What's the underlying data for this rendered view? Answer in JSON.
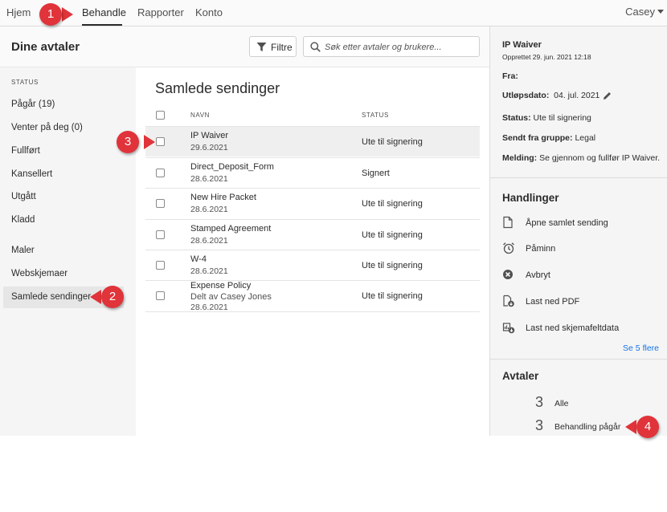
{
  "topnav": {
    "tabs": [
      "Hjem",
      "Behandle",
      "Rapporter",
      "Konto"
    ],
    "active_tab": "Behandle",
    "user": "Casey"
  },
  "header": {
    "title": "Dine avtaler",
    "filter_label": "Filtre",
    "search_placeholder": "Søk etter avtaler og brukere..."
  },
  "sidebar": {
    "status_heading": "STATUS",
    "items": [
      "Pågår (19)",
      "Venter på deg (0)",
      "Fullført",
      "Kansellert",
      "Utgått",
      "Kladd",
      "Maler",
      "Webskjemaer",
      "Samlede sendinger"
    ],
    "active": "Samlede sendinger"
  },
  "main": {
    "title": "Samlede sendinger",
    "col_name": "NAVN",
    "col_status": "STATUS",
    "rows": [
      {
        "name": "IP Waiver",
        "sub": "",
        "date": "29.6.2021",
        "status": "Ute til signering"
      },
      {
        "name": "Direct_Deposit_Form",
        "sub": "",
        "date": "28.6.2021",
        "status": "Signert"
      },
      {
        "name": "New Hire Packet",
        "sub": "",
        "date": "28.6.2021",
        "status": "Ute til signering"
      },
      {
        "name": "Stamped Agreement",
        "sub": "",
        "date": "28.6.2021",
        "status": "Ute til signering"
      },
      {
        "name": "W-4",
        "sub": "",
        "date": "28.6.2021",
        "status": "Ute til signering"
      },
      {
        "name": "Expense Policy",
        "sub": "Delt av Casey Jones",
        "date": "28.6.2021",
        "status": "Ute til signering"
      }
    ]
  },
  "details": {
    "name": "IP Waiver",
    "created": "Opprettet 29. jun. 2021 12:18",
    "from_label": "Fra:",
    "expiry_label": "Utløpsdato:",
    "expiry_value": "04. jul. 2021",
    "status_label": "Status:",
    "status_value": "Ute til signering",
    "group_label": "Sendt fra gruppe:",
    "group_value": "Legal",
    "message_label": "Melding:",
    "message_value": "Se gjennom og fullfør IP Waiver."
  },
  "actions": {
    "heading": "Handlinger",
    "items": [
      "Åpne samlet sending",
      "Påminn",
      "Avbryt",
      "Last ned PDF",
      "Last ned skjemafeltdata"
    ],
    "more": "Se 5 flere"
  },
  "agreements": {
    "heading": "Avtaler",
    "counts": [
      {
        "num": "3",
        "label": "Alle"
      },
      {
        "num": "3",
        "label": "Behandling pågår"
      }
    ]
  },
  "callouts": [
    "1",
    "2",
    "3",
    "4"
  ],
  "colors": {
    "callout": "#e0333a",
    "link": "#1473e6"
  }
}
